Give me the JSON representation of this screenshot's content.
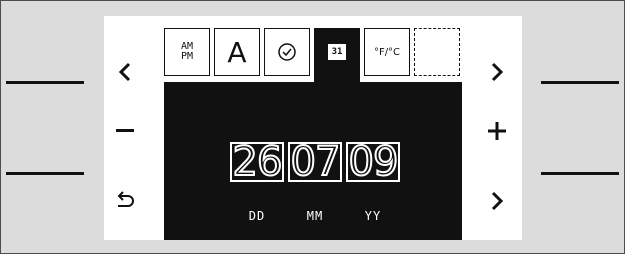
{
  "tabs": [
    {
      "name": "ampm",
      "label": "AM\nPM"
    },
    {
      "name": "font",
      "label": "A"
    },
    {
      "name": "clock",
      "label": ""
    },
    {
      "name": "calendar",
      "label": "31"
    },
    {
      "name": "temperature",
      "label": "°F/°C"
    },
    {
      "name": "empty",
      "label": ""
    }
  ],
  "date": {
    "day": "26",
    "month": "07",
    "year": "09",
    "day_label": "DD",
    "month_label": "MM",
    "year_label": "YY"
  },
  "icons": {
    "left": "chevron-left-icon",
    "right_top": "chevron-right-icon",
    "minus": "minus-icon",
    "plus": "plus-icon",
    "back": "return-arrow-icon",
    "right_bottom": "chevron-right-icon"
  },
  "colors": {
    "screen_bg": "#ffffff",
    "content_bg": "#111111",
    "panel_bg": "#dcdcdc"
  }
}
